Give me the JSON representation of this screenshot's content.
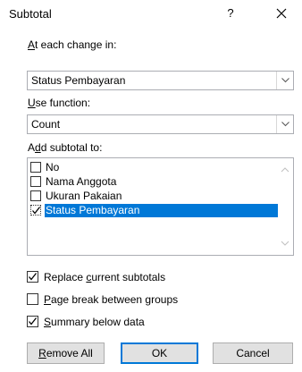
{
  "dialog": {
    "title": "Subtotal",
    "help": "?",
    "close": "✕"
  },
  "at_each_change": {
    "label_pre": "",
    "label_ul": "A",
    "label_post": "t each change in:",
    "value": "Status Pembayaran"
  },
  "use_function": {
    "label_pre": "",
    "label_ul": "U",
    "label_post": "se function:",
    "value": "Count"
  },
  "add_subtotal": {
    "label_pre": "A",
    "label_ul": "d",
    "label_post": "d subtotal to:",
    "items": [
      {
        "label": "No",
        "checked": false,
        "selected": false
      },
      {
        "label": "Nama Anggota",
        "checked": false,
        "selected": false
      },
      {
        "label": "Ukuran Pakaian",
        "checked": false,
        "selected": false
      },
      {
        "label": "Status Pembayaran",
        "checked": true,
        "selected": true
      }
    ]
  },
  "options": [
    {
      "pre": "Replace ",
      "ul": "c",
      "post": "urrent subtotals",
      "checked": true
    },
    {
      "pre": "",
      "ul": "P",
      "post": "age break between groups",
      "checked": false
    },
    {
      "pre": "",
      "ul": "S",
      "post": "ummary below data",
      "checked": true
    }
  ],
  "buttons": {
    "remove_all_ul": "R",
    "remove_all_post": "emove All",
    "ok": "OK",
    "cancel": "Cancel"
  }
}
